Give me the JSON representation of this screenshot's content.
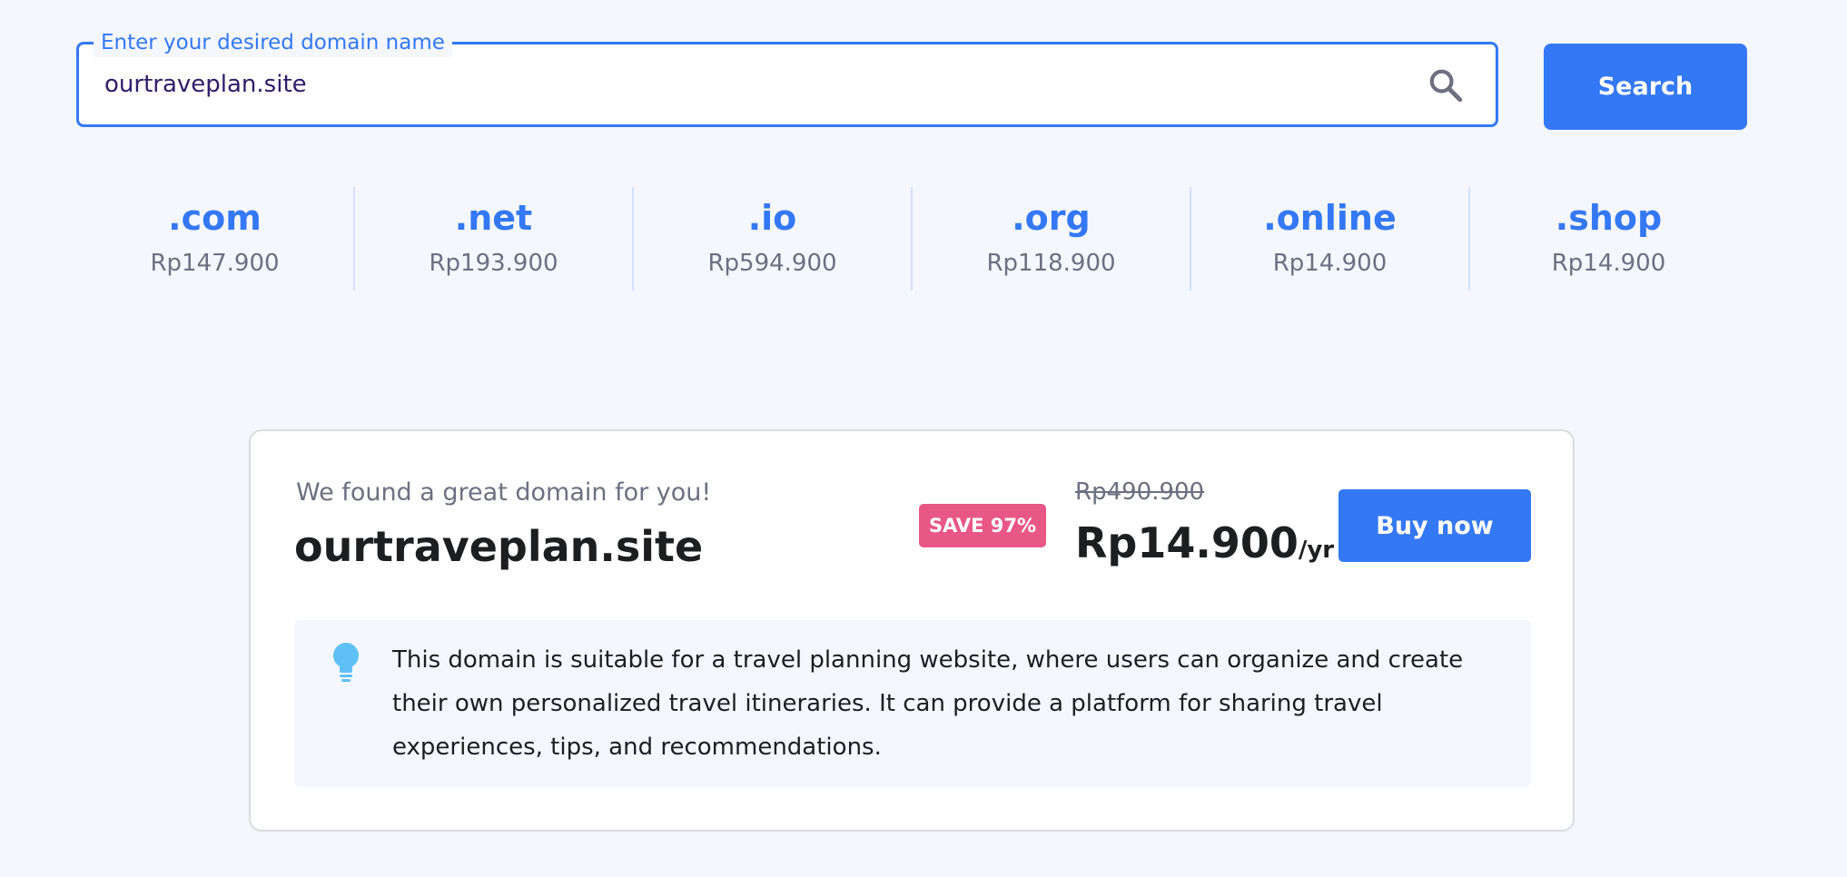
{
  "search": {
    "legend": "Enter your desired domain name",
    "value": "ourtraveplan.site",
    "button_label": "Search"
  },
  "tlds": [
    {
      "name": ".com",
      "price": "Rp147.900"
    },
    {
      "name": ".net",
      "price": "Rp193.900"
    },
    {
      "name": ".io",
      "price": "Rp594.900"
    },
    {
      "name": ".org",
      "price": "Rp118.900"
    },
    {
      "name": ".online",
      "price": "Rp14.900"
    },
    {
      "name": ".shop",
      "price": "Rp14.900"
    }
  ],
  "result": {
    "intro": "We found a great domain for you!",
    "domain": "ourtraveplan.site",
    "badge": "SAVE 97%",
    "old_price": "Rp490.900",
    "price": "Rp14.900",
    "period": "/yr",
    "buy_label": "Buy now",
    "suggestion": "This domain is suitable for a travel planning website, where users can organize and create their own personalized travel itineraries. It can provide a platform for sharing travel experiences, tips, and recommendations."
  },
  "colors": {
    "accent": "#3478f6",
    "badge": "#e95787",
    "background": "#f4f7fd",
    "bulb": "#5ec0f5"
  },
  "icons": {
    "search": "search-icon",
    "bulb": "lightbulb-icon"
  }
}
